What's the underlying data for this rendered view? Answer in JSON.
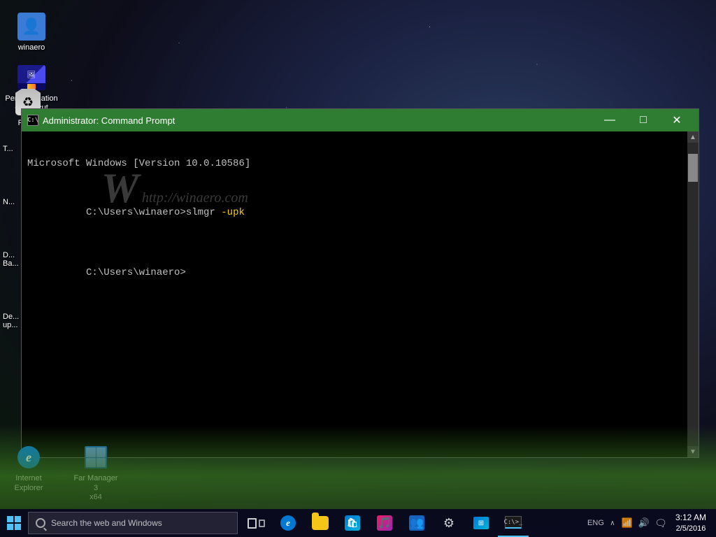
{
  "desktop": {
    "icons": [
      {
        "id": "winaero",
        "label": "winaero",
        "type": "person"
      },
      {
        "id": "personalization",
        "label": "Personalization\n- Shortcut",
        "type": "personalization"
      }
    ],
    "left_partial_icons": [
      {
        "id": "recycle-bin",
        "label": "Rec...",
        "type": "recycle"
      },
      {
        "id": "icon2",
        "label": "T...",
        "type": "folder"
      },
      {
        "id": "icon3",
        "label": "N...",
        "type": "folder"
      },
      {
        "id": "icon4",
        "label": "D...\nBa...",
        "type": "folder"
      },
      {
        "id": "icon5",
        "label": "De...\nup...",
        "type": "folder"
      }
    ],
    "bottom_icons": [
      {
        "id": "internet-explorer",
        "label": "Internet\nExplorer",
        "type": "ie"
      },
      {
        "id": "far-manager",
        "label": "Far Manager 3\nx64",
        "type": "far"
      }
    ]
  },
  "cmd_window": {
    "title": "Administrator: Command Prompt",
    "title_icon": "C:\\",
    "line1": "Microsoft Windows [Version 10.0.10586]",
    "line2_prompt": "C:\\Users\\winaero>",
    "line2_command": "slmgr",
    "line2_arg": " -upk",
    "line3_prompt": "C:\\Users\\winaero>",
    "controls": {
      "minimize": "—",
      "maximize": "□",
      "close": "✕"
    }
  },
  "watermark": {
    "logo": "W",
    "url": "http://winaero.com"
  },
  "taskbar": {
    "start_label": "Start",
    "search_placeholder": "Search the web and Windows",
    "buttons": [
      {
        "id": "task-view",
        "label": "Task View",
        "type": "task-view"
      },
      {
        "id": "edge",
        "label": "Microsoft Edge",
        "type": "edge"
      },
      {
        "id": "file-explorer",
        "label": "File Explorer",
        "type": "file-explorer"
      },
      {
        "id": "store",
        "label": "Store",
        "type": "store"
      },
      {
        "id": "media",
        "label": "Media Player",
        "type": "media"
      },
      {
        "id": "connect",
        "label": "Connect",
        "type": "connect"
      },
      {
        "id": "settings",
        "label": "Settings",
        "type": "settings"
      },
      {
        "id": "remote",
        "label": "Remote Desktop",
        "type": "remote"
      },
      {
        "id": "cmd",
        "label": "Command Prompt",
        "type": "cmd",
        "active": true
      }
    ],
    "tray": {
      "chevron": "^",
      "icons": [
        "language",
        "network",
        "volume",
        "notification"
      ],
      "time": "3:12 AM",
      "date": "2/5/2016"
    }
  }
}
